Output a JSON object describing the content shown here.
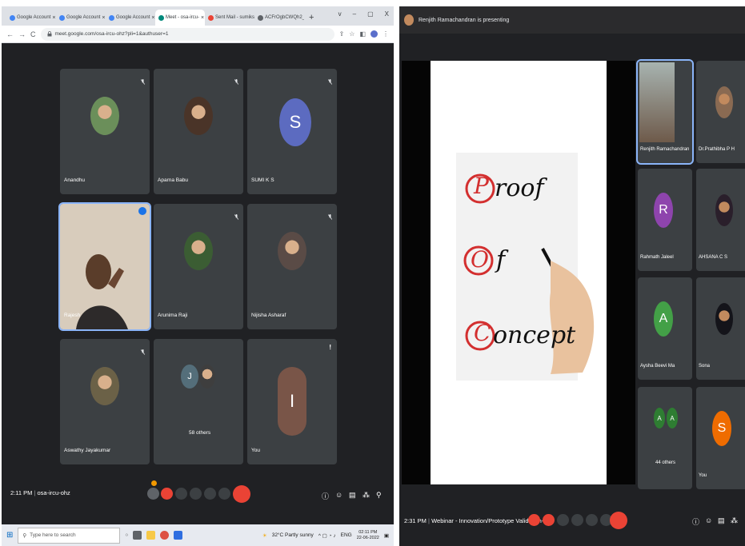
{
  "left": {
    "tabs": [
      {
        "label": "Google Account",
        "color": "#4285f4",
        "active": false
      },
      {
        "label": "Google Account",
        "color": "#4285f4",
        "active": false
      },
      {
        "label": "Google Account",
        "color": "#4285f4",
        "active": false
      },
      {
        "label": "Meet - osa-ircu-",
        "color": "#00897b",
        "active": true
      },
      {
        "label": "Sent Mail - sumiks@",
        "color": "#ea4335",
        "active": false
      },
      {
        "label": "ACFrOgbCWQh2_nR",
        "color": "#5f6368",
        "active": false
      }
    ],
    "new_tab": "+",
    "window_controls": [
      "v",
      "–",
      "▢",
      "X"
    ],
    "nav": {
      "back": "←",
      "forward": "→",
      "reload": "C"
    },
    "url": "meet.google.com/osa-ircu-ohz?pli=1&authuser=1",
    "participants": [
      {
        "name": "Anandhu",
        "type": "photo",
        "photo_bg": "#6b8f5a",
        "muted": true
      },
      {
        "name": "Aparna Babu",
        "type": "photo",
        "photo_bg": "#4a3428",
        "muted": true
      },
      {
        "name": "SUMI K S",
        "type": "letter",
        "letter": "S",
        "letter_bg": "#5c6bc0",
        "muted": true
      },
      {
        "name": "Rajesh",
        "type": "video",
        "muted": false
      },
      {
        "name": "Arunima Raji",
        "type": "photo",
        "photo_bg": "#3b5d33",
        "muted": true
      },
      {
        "name": "Nijisha Asharaf",
        "type": "photo",
        "photo_bg": "#5a4b46",
        "muted": true
      },
      {
        "name": "Aswathy Jayakumar",
        "type": "photo",
        "photo_bg": "#6b6147",
        "muted": true
      },
      {
        "name": "58 others",
        "type": "others",
        "letter": "J",
        "letter_bg": "#546e7a",
        "muted": false
      },
      {
        "name": "You",
        "type": "letter",
        "letter": "I",
        "letter_bg": "#795548",
        "muted": false,
        "alert": "!"
      }
    ],
    "meeting_time": "2:11 PM",
    "meeting_code": "osa-ircu-ohz",
    "taskbar": {
      "search_placeholder": "Type here to search",
      "weather": "32°C  Partly sunny",
      "lang": "ENG",
      "time": "02:11 PM",
      "date": "22-06-2022"
    }
  },
  "right": {
    "presenter": "Renjith Ramachandran is presenting",
    "slide_lines": [
      "roof",
      "f",
      "oncept"
    ],
    "slide_initials": [
      "P",
      "O",
      "C"
    ],
    "sidebar_tiles": [
      {
        "name": "Renjith Ramachandran",
        "type": "photo",
        "photo_bg": "#7a5d4a"
      },
      {
        "name": "Dr.Prathibha P H",
        "type": "photo",
        "photo_bg": "#8a6a52"
      },
      {
        "name": "Rahmath Jaleel",
        "type": "letter",
        "letter": "R",
        "letter_bg": "#8e44ad"
      },
      {
        "name": "AHSANA C S",
        "type": "photo",
        "photo_bg": "#2a1f2b"
      },
      {
        "name": "Aysha Beevi Ma",
        "type": "letter",
        "letter": "A",
        "letter_bg": "#43a047"
      },
      {
        "name": "Sona",
        "type": "photo",
        "photo_bg": "#14141a"
      },
      {
        "name": "44 others",
        "type": "others",
        "letter": "A",
        "letter_bg": "#2e7d32"
      },
      {
        "name": "You",
        "type": "letter",
        "letter": "S",
        "letter_bg": "#ef6c00"
      }
    ],
    "meeting_time": "2:31 PM",
    "meeting_title": "Webinar - Innovation/Prototype Validation-..."
  }
}
